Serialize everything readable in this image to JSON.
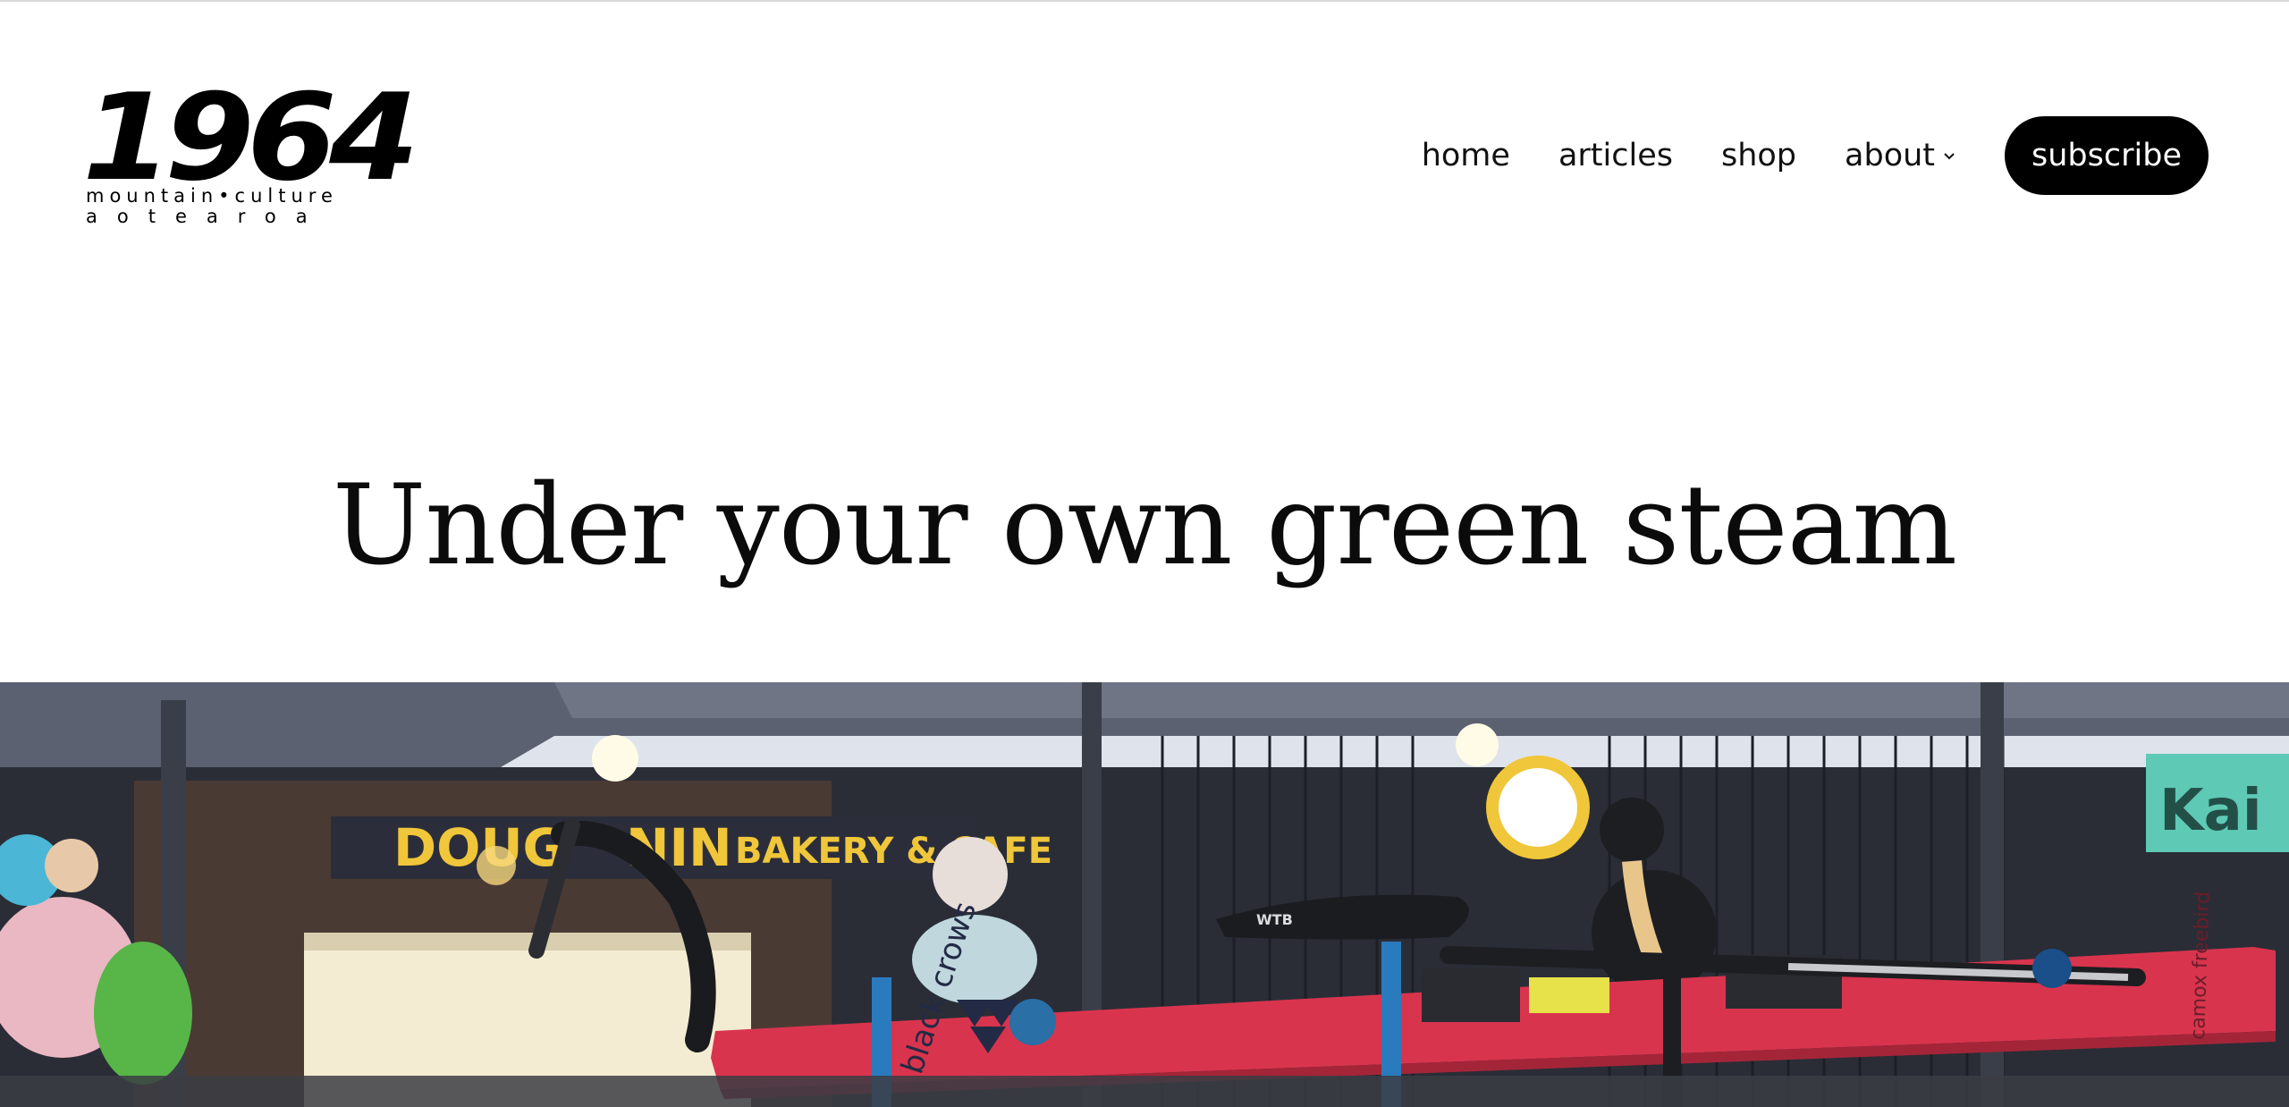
{
  "logo": {
    "mark": "1964",
    "line1": "mountain•culture",
    "line2": "aotearoa"
  },
  "nav": {
    "items": [
      {
        "label": "home"
      },
      {
        "label": "articles"
      },
      {
        "label": "shop"
      },
      {
        "label": "about",
        "has_dropdown": true
      }
    ],
    "subscribe_label": "subscribe"
  },
  "article": {
    "title": "Under your own green steam"
  },
  "hero": {
    "sign_left": "DOUG",
    "sign_mid": "NIN",
    "sign_right": "BAKERY & CAFE",
    "sign_far_right": "Kai",
    "ski_brand": "black crows",
    "saddle_brand": "WTB",
    "ski_brand_right": "camox freebird",
    "colors": {
      "ski": "#d9344e",
      "sky": "#dfe3ec",
      "wall": "#2a2d36",
      "sign_text": "#f0c63a"
    }
  },
  "colors": {
    "text": "#0a0a0a",
    "button_bg": "#000000",
    "button_text": "#ffffff"
  }
}
